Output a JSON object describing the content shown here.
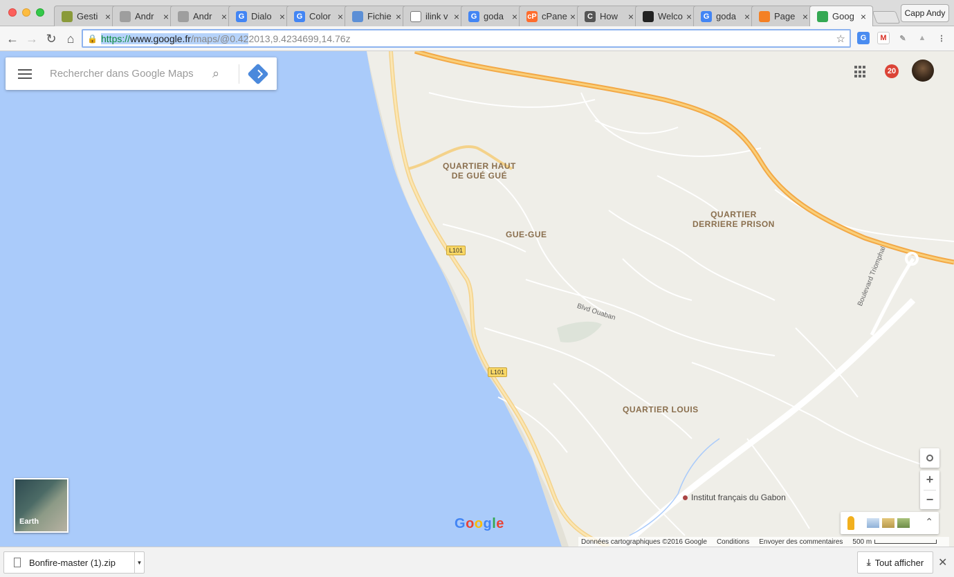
{
  "tabs": [
    {
      "title": "Gesti",
      "icon": "gestion-tab-icon",
      "color": "#8a9a3a",
      "glyph": ""
    },
    {
      "title": "Andr",
      "icon": "document-tab-icon",
      "color": "#9e9e9e",
      "glyph": ""
    },
    {
      "title": "Andr",
      "icon": "document-tab-icon",
      "color": "#9e9e9e",
      "glyph": ""
    },
    {
      "title": "Dialo",
      "icon": "google-tab-icon",
      "color": "#4285f4",
      "glyph": "G"
    },
    {
      "title": "Color",
      "icon": "google-tab-icon",
      "color": "#4285f4",
      "glyph": "G"
    },
    {
      "title": "Fichie",
      "icon": "play-tab-icon",
      "color": "#5c8fd6",
      "glyph": ""
    },
    {
      "title": "ilink v",
      "icon": "page-tab-icon",
      "color": "#ffffff",
      "glyph": ""
    },
    {
      "title": "goda",
      "icon": "google-tab-icon",
      "color": "#4285f4",
      "glyph": "G"
    },
    {
      "title": "cPane",
      "icon": "cpanel-tab-icon",
      "color": "#ff6c2c",
      "glyph": "cP"
    },
    {
      "title": "How",
      "icon": "howto-tab-icon",
      "color": "#555555",
      "glyph": "C"
    },
    {
      "title": "Welco",
      "icon": "welcome-tab-icon",
      "color": "#222222",
      "glyph": ""
    },
    {
      "title": "goda",
      "icon": "google-tab-icon",
      "color": "#4285f4",
      "glyph": "G"
    },
    {
      "title": "Page",
      "icon": "stackoverflow-tab-icon",
      "color": "#f48024",
      "glyph": ""
    },
    {
      "title": "Goog",
      "icon": "google-maps-tab-icon",
      "color": "#34a853",
      "glyph": ""
    }
  ],
  "profile_name": "Capp Andy",
  "address_bar": {
    "scheme": "https://",
    "host": "www.google.fr",
    "path": "/maps/@0.42",
    "rest": "2013,9.4234699,14.76z"
  },
  "search": {
    "placeholder": "Rechercher dans Google Maps"
  },
  "notifications_count": "20",
  "map_labels": {
    "quartier_haut": "QUARTIER HAUT\nDE GUÉ GUÉ",
    "gue_gue": "GUE-GUE",
    "quartier_derriere": "QUARTIER\nDERRIERE PRISON",
    "quartier_louis": "QUARTIER LOUIS",
    "bd_triomphal": "Boulevard Triomphal",
    "blvd_ouaban": "Blvd Ouaban",
    "road_shield_1": "L101",
    "road_shield_2": "L101",
    "poi": "Institut français du Gabon"
  },
  "earth_label": "Earth",
  "google_logo": "Google",
  "attribution": {
    "data": "Données cartographiques ©2016 Google",
    "conditions": "Conditions",
    "feedback": "Envoyer des commentaires",
    "scale": "500 m"
  },
  "download": {
    "filename": "Bonfire-master (1).zip",
    "show_all": "Tout afficher"
  }
}
